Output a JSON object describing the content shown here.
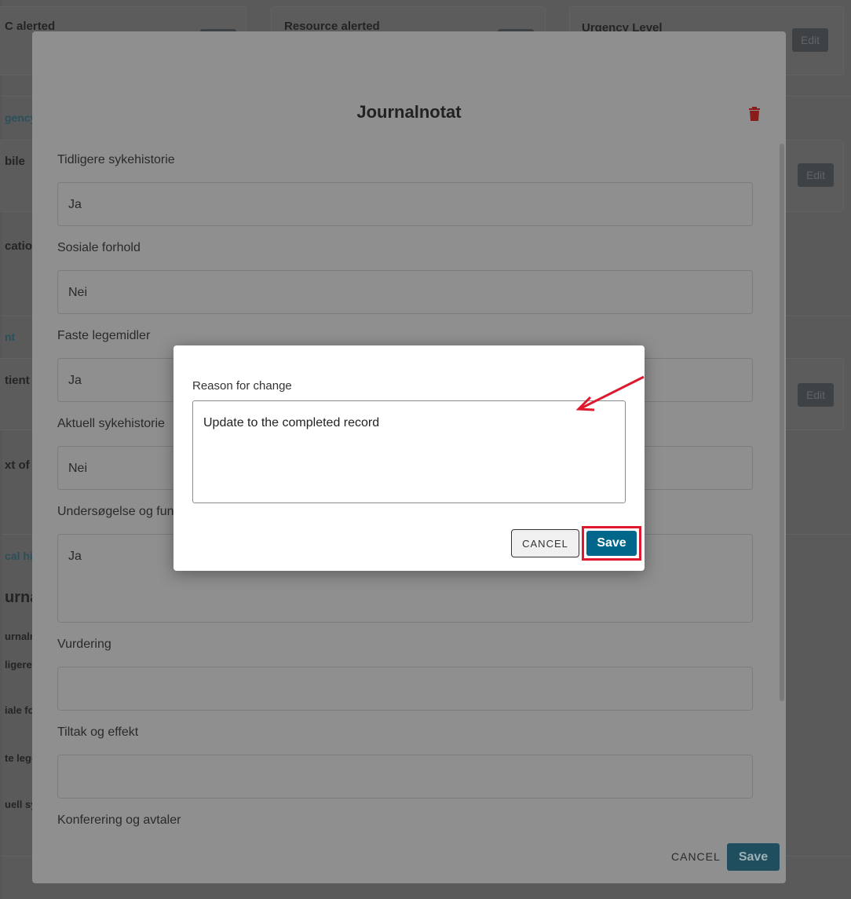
{
  "background": {
    "cards": [
      {
        "title": "C alerted"
      },
      {
        "title": "Resource alerted"
      },
      {
        "title": "Urgency Level",
        "edit_label": "Edit"
      }
    ],
    "left_fragments": [
      "gency",
      "bile",
      "cation",
      "nt",
      "tient",
      "xt of k",
      "cal his",
      "urna",
      "urnaln",
      "ligere s",
      "iale fo",
      "te lege",
      "uell sy"
    ],
    "edit_label": "Edit"
  },
  "journal_modal": {
    "title": "Journalnotat",
    "delete_icon": "trash-icon",
    "fields": [
      {
        "label": "Tidligere sykehistorie",
        "value": "Ja"
      },
      {
        "label": "Sosiale forhold",
        "value": "Nei"
      },
      {
        "label": "Faste legemidler",
        "value": "Ja"
      },
      {
        "label": "Aktuell sykehistorie",
        "value": "Nei"
      },
      {
        "label": "Undersøgelse og funn",
        "value": "Ja"
      },
      {
        "label": "Vurdering",
        "value": ""
      },
      {
        "label": "Tiltak og effekt",
        "value": ""
      },
      {
        "label": "Konferering og avtaler",
        "value": ""
      }
    ],
    "cancel_label": "CANCEL",
    "save_label": "Save"
  },
  "reason_dialog": {
    "label": "Reason for change",
    "value": "Update to the completed record",
    "cancel_label": "CANCEL",
    "save_label": "Save",
    "colors": {
      "save": "#00668a",
      "highlight": "#e0182d"
    }
  }
}
